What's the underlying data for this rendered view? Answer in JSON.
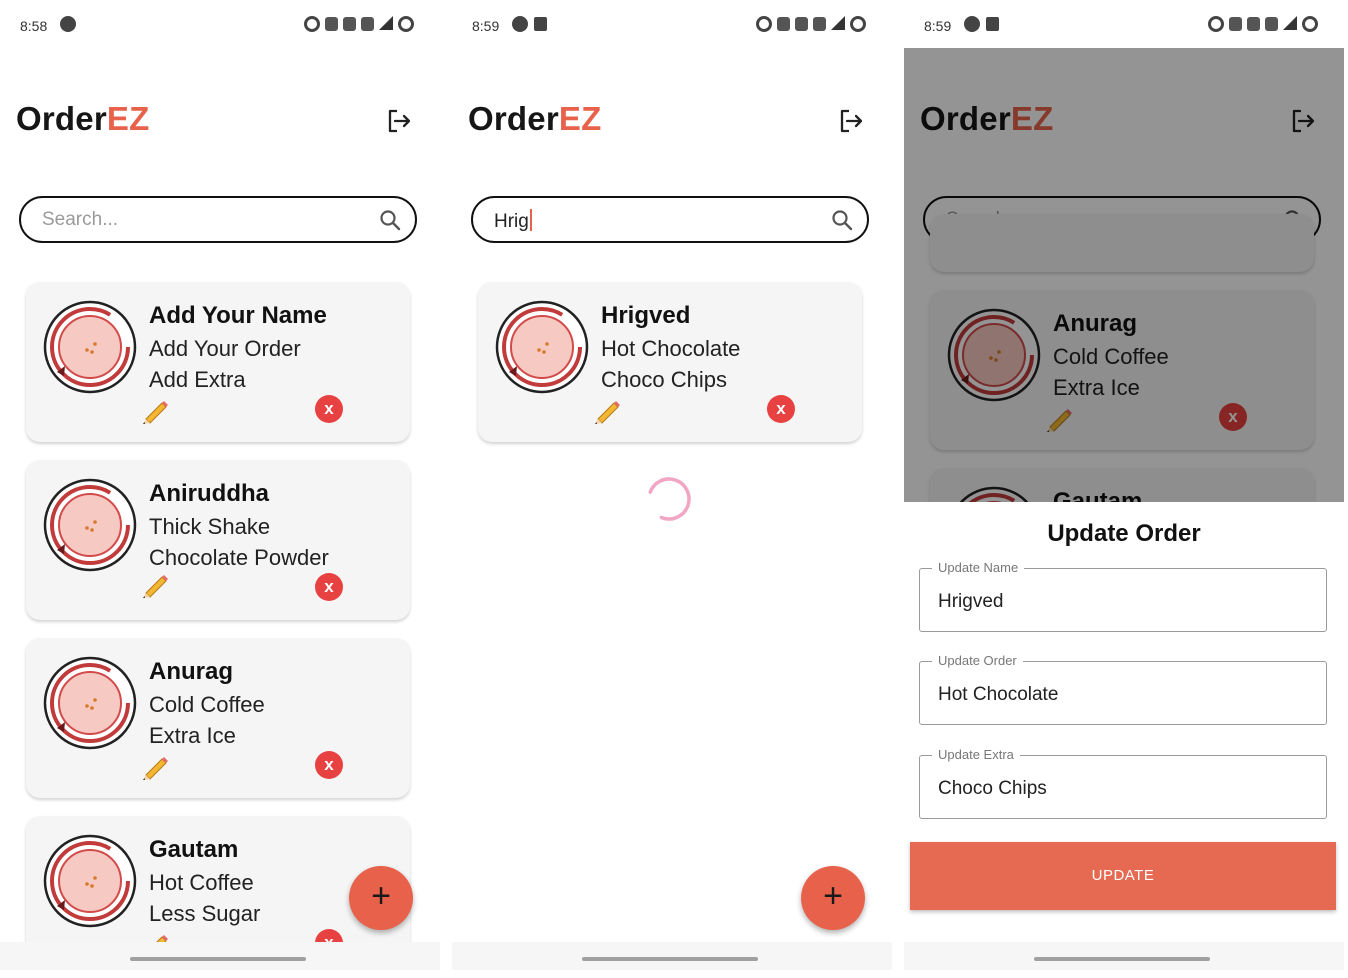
{
  "theme": {
    "accent": "#e8624b",
    "delete": "#e84141",
    "update_button": "#e66a51"
  },
  "screens": [
    {
      "status": {
        "time": "8:58"
      },
      "logo": {
        "part1": "Order",
        "part2": "EZ"
      },
      "search": {
        "placeholder": "Search...",
        "value": ""
      },
      "orders": [
        {
          "name": "Add Your Name",
          "order": "Add Your Order",
          "extra": "Add Extra"
        },
        {
          "name": "Aniruddha",
          "order": "Thick Shake",
          "extra": "Chocolate Powder"
        },
        {
          "name": "Anurag",
          "order": "Cold Coffee",
          "extra": "Extra Ice"
        },
        {
          "name": "Gautam",
          "order": "Hot Coffee",
          "extra": "Less Sugar"
        }
      ],
      "fab_label": "+"
    },
    {
      "status": {
        "time": "8:59"
      },
      "logo": {
        "part1": "Order",
        "part2": "EZ"
      },
      "search": {
        "placeholder": "Search...",
        "value": "Hrig"
      },
      "orders": [
        {
          "name": "Hrigved",
          "order": "Hot Chocolate",
          "extra": "Choco Chips"
        }
      ],
      "fab_label": "+"
    },
    {
      "status": {
        "time": "8:59"
      },
      "logo": {
        "part1": "Order",
        "part2": "EZ"
      },
      "search": {
        "placeholder": "Search...",
        "value": ""
      },
      "orders": [
        {
          "name": "Anurag",
          "order": "Cold Coffee",
          "extra": "Extra Ice"
        },
        {
          "name": "Gautam",
          "order": "",
          "extra": ""
        }
      ],
      "dialog": {
        "title": "Update Order",
        "fields": [
          {
            "label": "Update Name",
            "value": "Hrigved"
          },
          {
            "label": "Update Order",
            "value": "Hot Chocolate"
          },
          {
            "label": "Update Extra",
            "value": "Choco Chips"
          }
        ],
        "button": "UPDATE"
      }
    }
  ],
  "icons": {
    "delete": "x",
    "logout": "logout-icon",
    "search": "search-icon",
    "edit": "pencil-icon",
    "avatar": "clock-avatar-icon"
  }
}
